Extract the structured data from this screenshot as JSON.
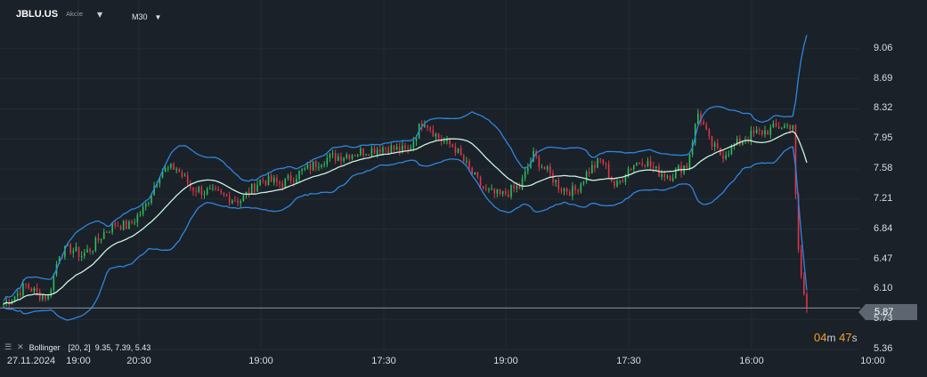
{
  "header": {
    "symbol": "JBLU.US",
    "asset_type": "Akcie",
    "symbol_caret_icon": "caret-down-icon",
    "timeframe": "M30",
    "timeframe_caret_icon": "caret-down-icon"
  },
  "indicator": {
    "icons": [
      "bars-icon",
      "close-icon"
    ],
    "name": "Bollinger",
    "params": "[20, 2]",
    "values": "9.35, 7.39, 5.43"
  },
  "countdown": {
    "minutes": "04",
    "min_unit": "m",
    "seconds": "47",
    "sec_unit": "s"
  },
  "current_price": "5.87",
  "colors": {
    "background": "#1a2128",
    "grid": "#232c35",
    "bullish": "#2ebd5b",
    "bearish": "#e0344a",
    "band": "#2f86e0",
    "middle": "#c9f2e0",
    "countdown": "#f0a030",
    "price_tag": "#5d6670"
  },
  "chart_data": {
    "type": "candlestick",
    "ylim": [
      5.36,
      9.43
    ],
    "y_ticks": [
      "9.06",
      "8.69",
      "8.32",
      "7.95",
      "7.58",
      "7.21",
      "6.84",
      "6.47",
      "6.10",
      "5.73",
      "5.36"
    ],
    "x_ticks": [
      "27.11.2024",
      "19:00",
      "20:30",
      "19:00",
      "17:30",
      "19:00",
      "17:30",
      "16:00",
      "10:00"
    ],
    "segments": [
      {
        "n": 45,
        "close_path": [
          5.92,
          6.02,
          6.15,
          6.05,
          6.0,
          6.55,
          6.6,
          6.52,
          6.62,
          6.8,
          6.9,
          6.88
        ]
      },
      {
        "n": 40,
        "close_path": [
          6.88,
          7.1,
          7.55,
          7.6,
          7.35,
          7.3,
          7.25,
          7.2
        ]
      },
      {
        "n": 60,
        "close_path": [
          7.2,
          7.45,
          7.4,
          7.55,
          7.7,
          7.75,
          7.8,
          7.85,
          7.8
        ]
      },
      {
        "n": 40,
        "close_path": [
          7.8,
          8.2,
          7.95,
          7.85,
          7.55,
          7.3,
          7.25,
          7.35
        ]
      },
      {
        "n": 60,
        "close_path": [
          7.35,
          7.75,
          7.55,
          7.35,
          7.3,
          7.55,
          7.7,
          7.35,
          7.6,
          7.7,
          7.55,
          7.5,
          7.62
        ]
      },
      {
        "n": 38,
        "close_path": [
          7.62,
          8.28,
          7.9,
          7.75,
          7.85,
          7.95,
          8.02,
          8.05,
          8.1,
          8.12
        ]
      },
      {
        "n": 6,
        "close_path": [
          8.12,
          6.7,
          6.15,
          5.87
        ]
      }
    ],
    "bollinger": {
      "period": 20,
      "stddev": 2,
      "upper": 9.35,
      "middle": 7.39,
      "lower": 5.43
    }
  }
}
